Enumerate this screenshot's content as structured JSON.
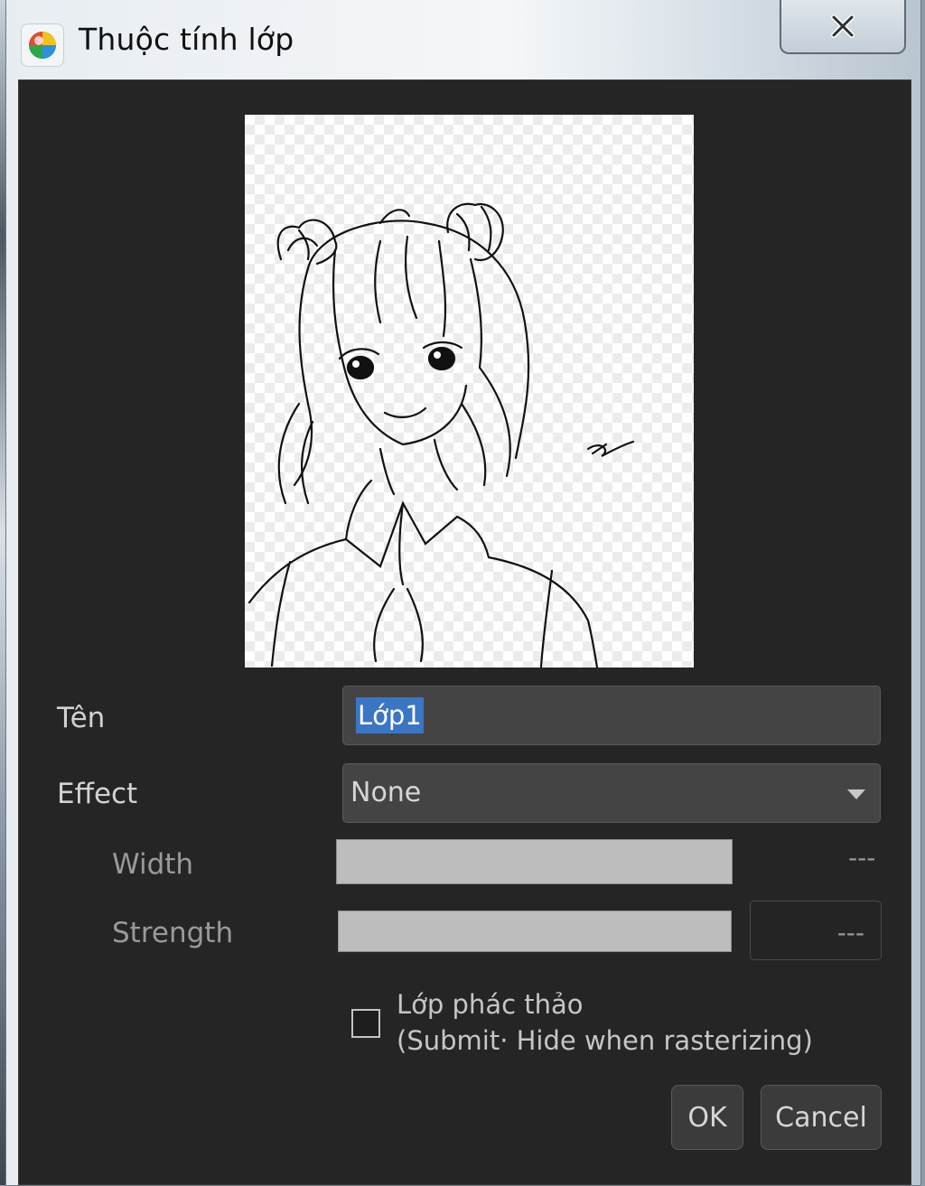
{
  "window": {
    "title": "Thuộc tính lớp",
    "close_glyph": "✕",
    "app_icon": "medibang-paint-icon"
  },
  "preview": {
    "content": "layer-thumbnail-sketch"
  },
  "form": {
    "name_label": "Tên",
    "name_value": "Lớp1",
    "effect_label": "Effect",
    "effect_value": "None",
    "width_label": "Width",
    "width_value": "---",
    "strength_label": "Strength",
    "strength_value": "---",
    "draft_checkbox_label": "Lớp phác thảo",
    "draft_checkbox_sublabel": "(Submit· Hide when rasterizing)",
    "draft_checked": false
  },
  "buttons": {
    "ok": "OK",
    "cancel": "Cancel"
  },
  "colors": {
    "dialog_bg": "#252525",
    "field_bg": "#444444",
    "selection": "#3b76c5",
    "slider_fill": "#bdbdbd"
  }
}
